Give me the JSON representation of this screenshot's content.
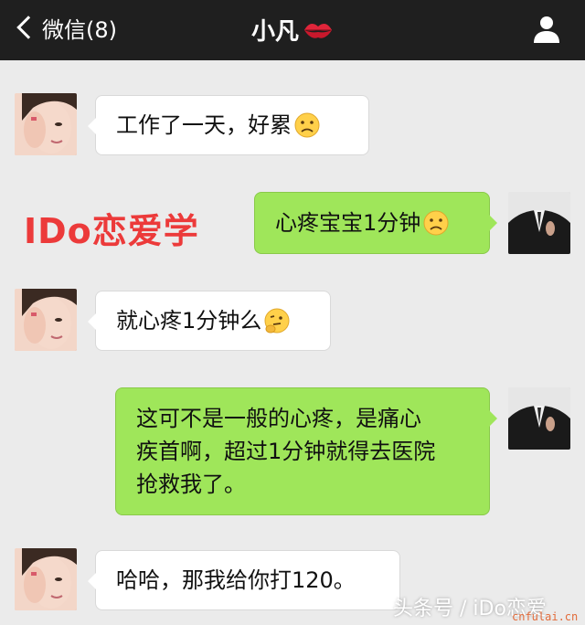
{
  "header": {
    "back_label": "微信(8)",
    "title": "小凡"
  },
  "brand_text": "IDo恋爱学",
  "messages": [
    {
      "sender": "her",
      "text": "工作了一天，好累",
      "emoji": "worried-face-icon"
    },
    {
      "sender": "me",
      "text": "心疼宝宝1分钟",
      "emoji": "worried-face-icon"
    },
    {
      "sender": "her",
      "text": "就心疼1分钟么",
      "emoji": "thinking-face-icon"
    },
    {
      "sender": "me",
      "lines": [
        "这可不是一般的心疼，是痛心",
        "疾首啊，超过1分钟就得去医院",
        "抢救我了。"
      ]
    },
    {
      "sender": "her",
      "text": "哈哈，那我给你打120。"
    }
  ],
  "watermark": "头条号 / iDo恋爱",
  "site_mark": "cnfulai.cn",
  "colors": {
    "header_bg": "#1f1f1f",
    "chat_bg": "#ebebeb",
    "outgoing_bubble": "#9fe65a",
    "incoming_bubble": "#ffffff",
    "brand": "#ec3a3a"
  }
}
